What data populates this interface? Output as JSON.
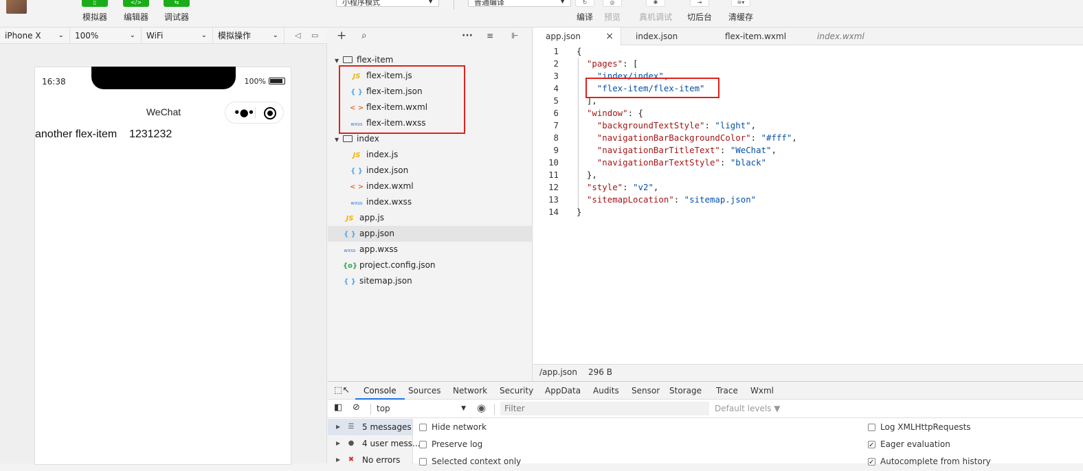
{
  "toolbar": {
    "simulator_label": "模拟器",
    "editor_label": "编辑器",
    "debugger_label": "调试器",
    "mode_select": "小程序模式",
    "compile_select": "普通编译",
    "compile_label": "编译",
    "preview_label": "预览",
    "realdevice_label": "真机调试",
    "background_label": "切后台",
    "clearcache_label": "清缓存"
  },
  "simbar": {
    "device": "iPhone X",
    "zoom": "100%",
    "network": "WiFi",
    "operation": "模拟操作"
  },
  "phone": {
    "time": "16:38",
    "battery": "100%",
    "title": "WeChat",
    "content": "another flex-item    1231232"
  },
  "explorer": {
    "tree": [
      {
        "type": "folder",
        "label": "flex-item"
      },
      {
        "type": "file",
        "icon": "js",
        "glyph": "JS",
        "label": "flex-item.js"
      },
      {
        "type": "file",
        "icon": "json",
        "glyph": "{ }",
        "label": "flex-item.json"
      },
      {
        "type": "file",
        "icon": "wxml",
        "glyph": "< >",
        "label": "flex-item.wxml"
      },
      {
        "type": "file",
        "icon": "wxss",
        "glyph": "wxss",
        "label": "flex-item.wxss"
      },
      {
        "type": "folder",
        "label": "index"
      },
      {
        "type": "file",
        "icon": "js",
        "glyph": "JS",
        "label": "index.js"
      },
      {
        "type": "file",
        "icon": "json",
        "glyph": "{ }",
        "label": "index.json"
      },
      {
        "type": "file",
        "icon": "wxml",
        "glyph": "< >",
        "label": "index.wxml"
      },
      {
        "type": "file",
        "icon": "wxss",
        "glyph": "wxss",
        "label": "index.wxss"
      },
      {
        "type": "file",
        "icon": "js",
        "glyph": "JS",
        "label": "app.js"
      },
      {
        "type": "file",
        "icon": "json",
        "glyph": "{ }",
        "label": "app.json",
        "active": true
      },
      {
        "type": "file",
        "icon": "wxss",
        "glyph": "wxss",
        "label": "app.wxss"
      },
      {
        "type": "file",
        "icon": "cfg",
        "glyph": "{o}",
        "label": "project.config.json"
      },
      {
        "type": "file",
        "icon": "json",
        "glyph": "{ }",
        "label": "sitemap.json"
      }
    ]
  },
  "editor": {
    "tabs": [
      {
        "label": "app.json",
        "active": true
      },
      {
        "label": "index.json"
      },
      {
        "label": "flex-item.wxml"
      },
      {
        "label": "index.wxml",
        "italic": true
      }
    ],
    "lines": [
      [
        {
          "t": "{",
          "c": ""
        }
      ],
      [
        {
          "t": "  ",
          "c": ""
        },
        {
          "t": "\"pages\"",
          "c": "k"
        },
        {
          "t": ": [",
          "c": ""
        }
      ],
      [
        {
          "t": "    ",
          "c": ""
        },
        {
          "t": "\"index/index\"",
          "c": "s"
        },
        {
          "t": ",",
          "c": ""
        }
      ],
      [
        {
          "t": "    ",
          "c": ""
        },
        {
          "t": "\"flex-item/flex-item\"",
          "c": "s"
        }
      ],
      [
        {
          "t": "  ],",
          "c": ""
        }
      ],
      [
        {
          "t": "  ",
          "c": ""
        },
        {
          "t": "\"window\"",
          "c": "k"
        },
        {
          "t": ": {",
          "c": ""
        }
      ],
      [
        {
          "t": "    ",
          "c": ""
        },
        {
          "t": "\"backgroundTextStyle\"",
          "c": "k"
        },
        {
          "t": ": ",
          "c": ""
        },
        {
          "t": "\"light\"",
          "c": "s"
        },
        {
          "t": ",",
          "c": ""
        }
      ],
      [
        {
          "t": "    ",
          "c": ""
        },
        {
          "t": "\"navigationBarBackgroundColor\"",
          "c": "k"
        },
        {
          "t": ": ",
          "c": ""
        },
        {
          "t": "\"#fff\"",
          "c": "s"
        },
        {
          "t": ",",
          "c": ""
        }
      ],
      [
        {
          "t": "    ",
          "c": ""
        },
        {
          "t": "\"navigationBarTitleText\"",
          "c": "k"
        },
        {
          "t": ": ",
          "c": ""
        },
        {
          "t": "\"WeChat\"",
          "c": "s"
        },
        {
          "t": ",",
          "c": ""
        }
      ],
      [
        {
          "t": "    ",
          "c": ""
        },
        {
          "t": "\"navigationBarTextStyle\"",
          "c": "k"
        },
        {
          "t": ": ",
          "c": ""
        },
        {
          "t": "\"black\"",
          "c": "s"
        }
      ],
      [
        {
          "t": "  },",
          "c": ""
        }
      ],
      [
        {
          "t": "  ",
          "c": ""
        },
        {
          "t": "\"style\"",
          "c": "k"
        },
        {
          "t": ": ",
          "c": ""
        },
        {
          "t": "\"v2\"",
          "c": "s"
        },
        {
          "t": ",",
          "c": ""
        }
      ],
      [
        {
          "t": "  ",
          "c": ""
        },
        {
          "t": "\"sitemapLocation\"",
          "c": "k"
        },
        {
          "t": ": ",
          "c": ""
        },
        {
          "t": "\"sitemap.json\"",
          "c": "s"
        }
      ],
      [
        {
          "t": "}",
          "c": ""
        }
      ]
    ]
  },
  "status": {
    "path": "/app.json",
    "size": "296 B"
  },
  "devtools": {
    "tabs": [
      "Console",
      "Sources",
      "Network",
      "Security",
      "AppData",
      "Audits",
      "Sensor",
      "Storage",
      "Trace",
      "Wxml"
    ],
    "context": "top",
    "filter_placeholder": "Filter",
    "levels": "Default levels ▼",
    "messages": [
      "5 messages",
      "4 user mess...",
      "No errors"
    ],
    "options_left": [
      {
        "label": "Hide network",
        "checked": false
      },
      {
        "label": "Preserve log",
        "checked": false
      },
      {
        "label": "Selected context only",
        "checked": false
      }
    ],
    "options_right": [
      {
        "label": "Log XMLHttpRequests",
        "checked": false
      },
      {
        "label": "Eager evaluation",
        "checked": true
      },
      {
        "label": "Autocomplete from history",
        "checked": true
      }
    ]
  },
  "colors": {
    "green": "#1aad19",
    "highlight_red": "#e0201c",
    "json_key": "#a31515",
    "json_string": "#0451a5"
  }
}
